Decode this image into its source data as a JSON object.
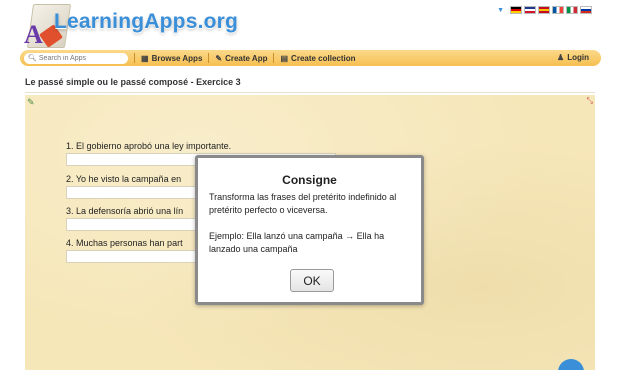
{
  "header": {
    "logo_text": "LearningApps.org",
    "languages": [
      "de",
      "en",
      "es",
      "fr",
      "it",
      "ru"
    ],
    "flag_colors": {
      "de": [
        "#000000",
        "#dd0000",
        "#ffce00"
      ],
      "en": [
        "#1f3a8c",
        "#ffffff",
        "#cf142b"
      ],
      "es": [
        "#c60b1e",
        "#ffc400",
        "#c60b1e"
      ],
      "fr": [
        "#0055a4",
        "#ffffff",
        "#ef4135"
      ],
      "it": [
        "#009246",
        "#ffffff",
        "#ce2b37"
      ],
      "ru": [
        "#ffffff",
        "#0039a6",
        "#d52b1e"
      ]
    }
  },
  "nav": {
    "search_placeholder": "Search in Apps",
    "browse": "Browse Apps",
    "create_app": "Create App",
    "create_collection": "Create collection",
    "login": "Login"
  },
  "page": {
    "title": "Le passé simple ou le passé composé - Exercice 3"
  },
  "exercise": {
    "questions": [
      "1. El gobierno aprobó una ley importante.",
      "2. Yo he visto la campaña en",
      "3. La defensoría abrió una lín",
      "4. Muchas personas han part"
    ]
  },
  "modal": {
    "title": "Consigne",
    "instruction": "Transforma las frases del pretérito indefinido al pretérito perfecto o viceversa.",
    "example": "Ejemplo: Ella lanzó una campaña → Ella ha lanzado una campaña",
    "ok_label": "OK"
  }
}
